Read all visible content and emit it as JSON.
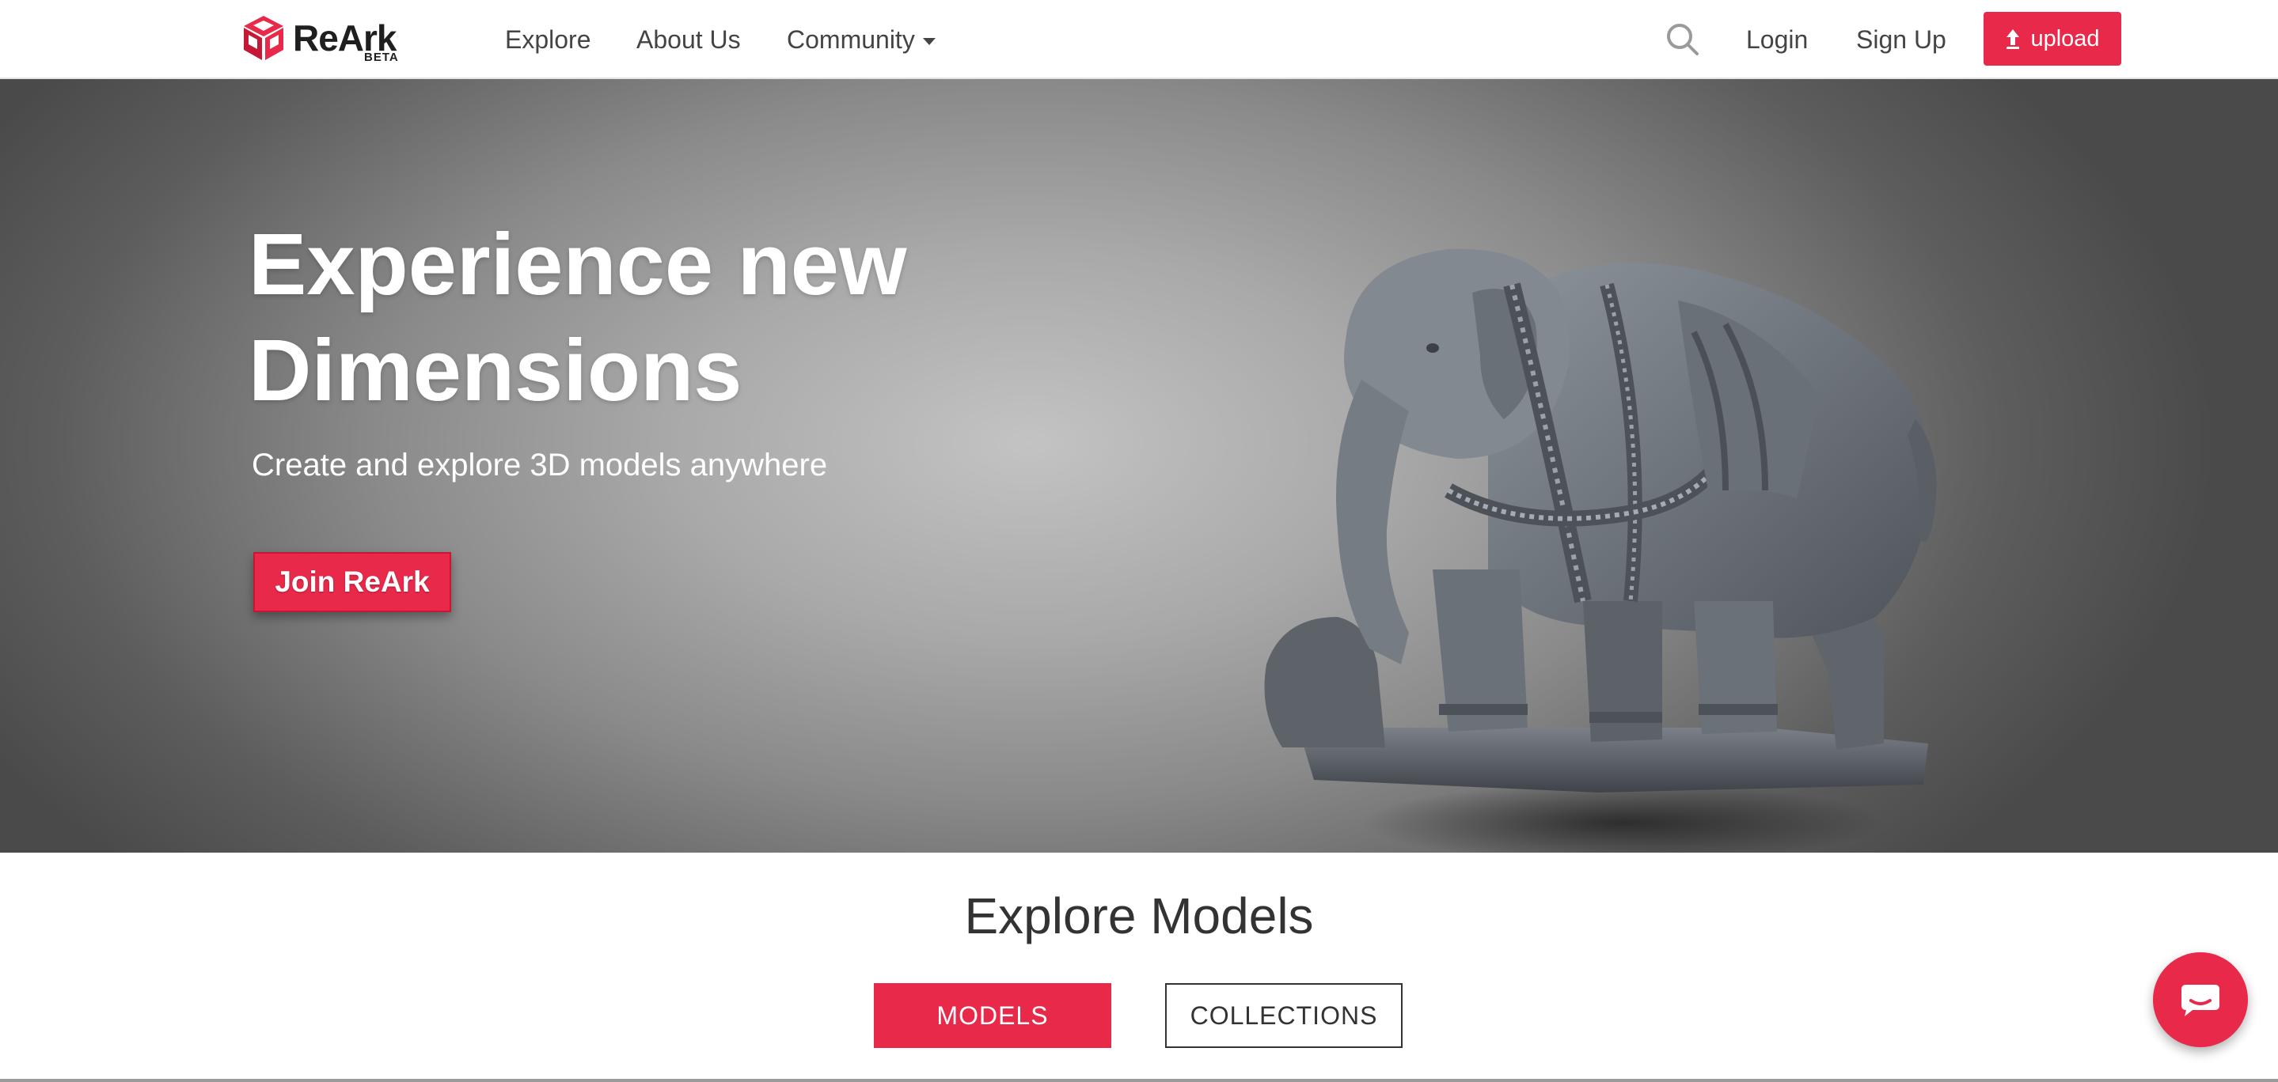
{
  "brand": {
    "name": "ReArk",
    "badge": "BETA",
    "accent": "#e8294a"
  },
  "nav": {
    "links": [
      {
        "label": "Explore"
      },
      {
        "label": "About Us"
      },
      {
        "label": "Community",
        "icon": "caret-down-icon"
      }
    ],
    "search_icon": "search-icon",
    "login": "Login",
    "signup": "Sign Up",
    "upload": "upload"
  },
  "hero": {
    "title_line1": "Experience new",
    "title_line2": "Dimensions",
    "subtitle": "Create and explore 3D models anywhere",
    "cta": "Join ReArk",
    "image": "stone-elephant-sculpture"
  },
  "explore": {
    "title": "Explore Models",
    "tabs": [
      {
        "label": "MODELS",
        "active": true
      },
      {
        "label": "COLLECTIONS",
        "active": false
      }
    ]
  },
  "chat": {
    "icon": "chat-icon"
  }
}
